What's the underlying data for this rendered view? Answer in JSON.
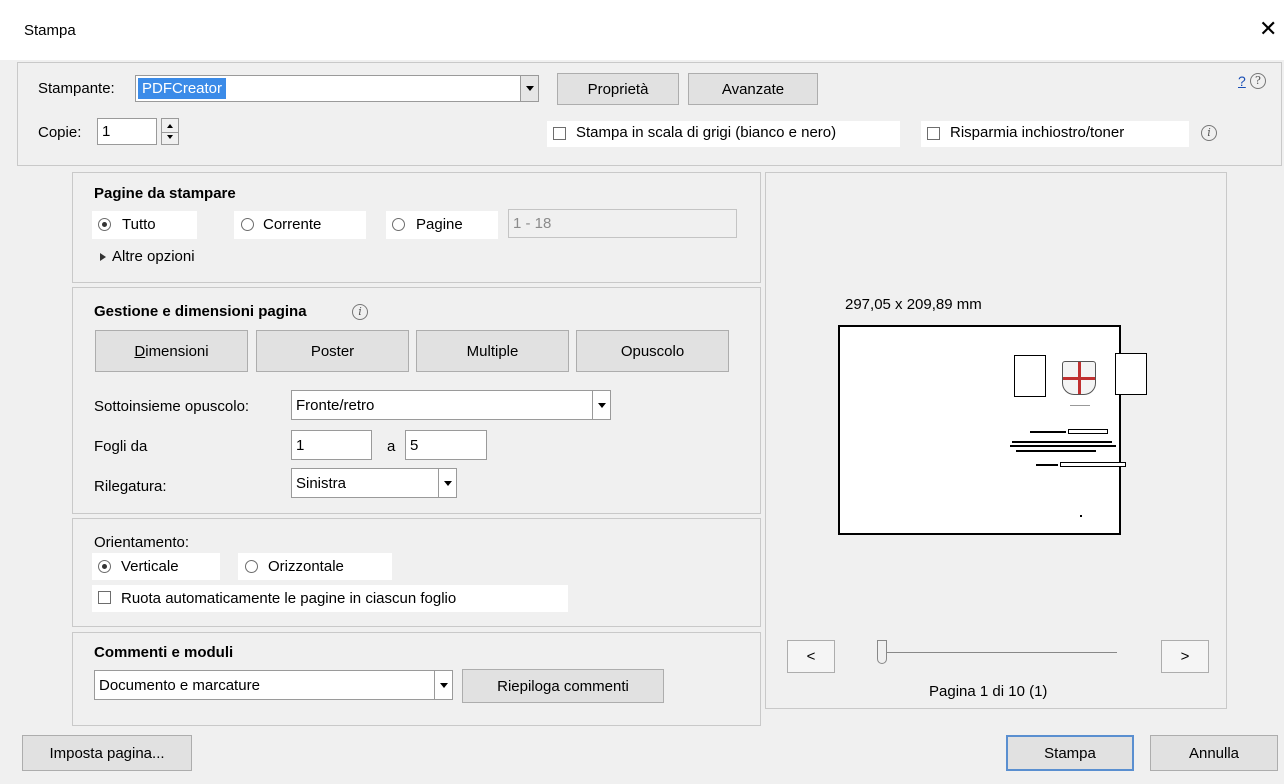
{
  "window": {
    "title": "Stampa",
    "close_glyph": "✕"
  },
  "printer": {
    "label": "Stampante:",
    "selected": "PDFCreator",
    "properties_button": "Proprietà",
    "advanced_button": "Avanzate",
    "help_link": "?"
  },
  "copies": {
    "label": "Copie:",
    "value": "1"
  },
  "options": {
    "grayscale_label": "Stampa in scala di grigi (bianco e nero)",
    "grayscale_checked": false,
    "save_ink_label": "Risparmia inchiostro/toner",
    "save_ink_checked": false
  },
  "pages_section": {
    "heading": "Pagine da stampare",
    "radio_all": "Tutto",
    "radio_current": "Corrente",
    "radio_pages": "Pagine",
    "selected": "Tutto",
    "pages_range": "1 - 18",
    "more_options": "Altre opzioni"
  },
  "page_handling": {
    "heading": "Gestione e dimensioni pagina",
    "tabs": [
      {
        "label": "Dimensioni",
        "mnemonic": "D",
        "rest": "imensioni"
      },
      {
        "label": "Poster"
      },
      {
        "label": "Multiple"
      },
      {
        "label": "Opuscolo"
      }
    ],
    "booklet_subset_label": "Sottoinsieme opuscolo:",
    "booklet_subset_value": "Fronte/retro",
    "sheets_from_label": "Fogli da",
    "sheets_from_value": "1",
    "sheets_to_label": "a",
    "sheets_to_value": "5",
    "binding_label": "Rilegatura:",
    "binding_value": "Sinistra"
  },
  "orientation": {
    "heading": "Orientamento:",
    "radio_portrait": "Verticale",
    "radio_landscape": "Orizzontale",
    "selected": "Verticale",
    "auto_rotate_label": "Ruota automaticamente le pagine in ciascun foglio",
    "auto_rotate_checked": false
  },
  "comments": {
    "heading": "Commenti e moduli",
    "select_value": "Documento e marcature",
    "summarize_button": "Riepiloga commenti"
  },
  "preview": {
    "dimensions": "297,05 x 209,89 mm",
    "prev_button": "<",
    "next_button": ">",
    "page_status": "Pagina 1 di 10 (1)",
    "slider_fraction": 0.0
  },
  "footer": {
    "page_setup_button": "Imposta pagina...",
    "print_button": "Stampa",
    "cancel_button": "Annulla"
  }
}
